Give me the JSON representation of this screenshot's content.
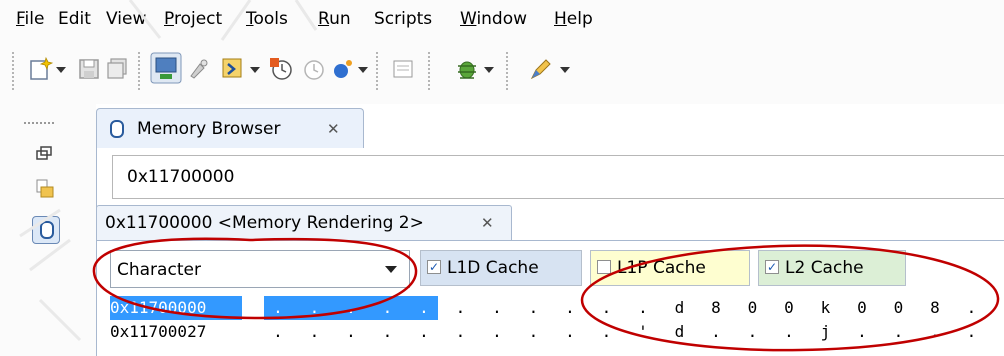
{
  "menu": [
    {
      "label": "File",
      "underline_index": 0
    },
    {
      "label": "Edit",
      "underline_index": -1
    },
    {
      "label": "View",
      "underline_index": -1
    },
    {
      "label": "Project",
      "underline_index": 0
    },
    {
      "label": "Tools",
      "underline_index": 0
    },
    {
      "label": "Run",
      "underline_index": 0
    },
    {
      "label": "Scripts",
      "underline_index": -1
    },
    {
      "label": "Window",
      "underline_index": 0
    },
    {
      "label": "Help",
      "underline_index": 0
    }
  ],
  "toolbar": {
    "icons": [
      "new-wizard-icon",
      "save-icon",
      "save-all-icon",
      "target-config-icon",
      "brush-icon",
      "debug-launch-icon",
      "clock-breakpoint-icon",
      "clock-disabled-icon",
      "run-dot-icon",
      "terminal-icon",
      "bug-debug-icon",
      "pencil-tool-icon"
    ]
  },
  "left_strip": {
    "icons": [
      "restore-icon",
      "folder-copy-icon",
      "memory-browser-icon"
    ]
  },
  "memory_browser": {
    "tab_title": "Memory Browser",
    "tab_close": "✕",
    "address_value": "0x11700000",
    "rendering_tab_title": "0x11700000 <Memory Rendering 2>",
    "rendering_tab_close": "✕",
    "format_selected": "Character",
    "caches": [
      {
        "label": "L1D Cache",
        "checked": true,
        "bg": "#d7e3f2"
      },
      {
        "label": "L1P Cache",
        "checked": false,
        "bg": "#fefed0"
      },
      {
        "label": "L2 Cache",
        "checked": true,
        "bg": "#dcefd6"
      }
    ],
    "rows": [
      {
        "address": "0x11700000",
        "cells": [
          ".",
          ".",
          ".",
          ".",
          ".",
          ".",
          ".",
          ".",
          ".",
          ".",
          ".",
          "d",
          "8",
          "0",
          "0",
          "k",
          "0",
          "0",
          "8",
          "."
        ],
        "selected_count": 5
      },
      {
        "address": "0x11700027",
        "cells": [
          ".",
          ".",
          ".",
          ".",
          ".",
          ".",
          ".",
          ".",
          ".",
          ".",
          "'",
          "d",
          ".",
          ".",
          ".",
          "j",
          ".",
          ".",
          ".",
          "."
        ],
        "selected_count": 0
      }
    ]
  },
  "colors": {
    "selection": "#3399ff",
    "annotation": "#c00000",
    "tab_border": "#a8b8cf"
  }
}
